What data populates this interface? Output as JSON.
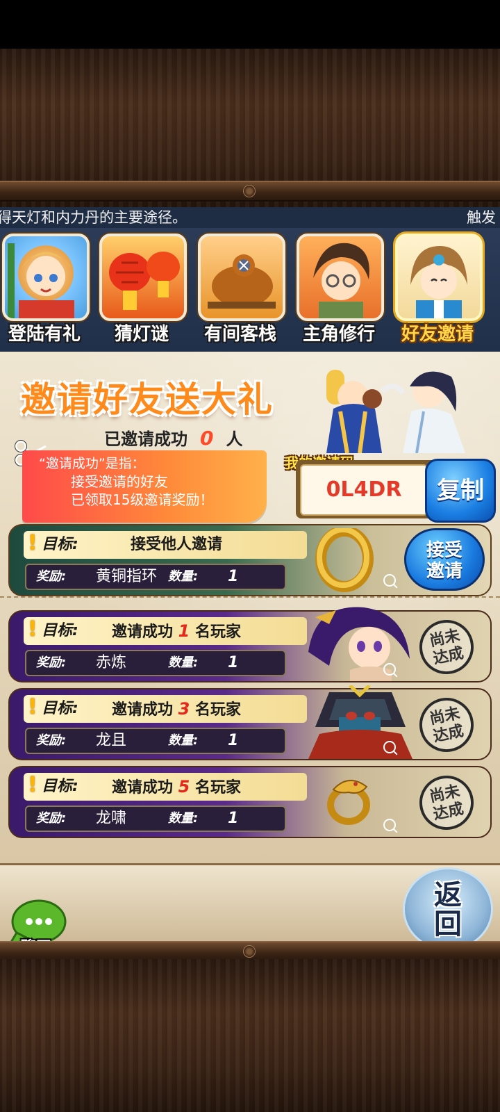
{
  "marquee": {
    "left_text": "得天灯和内力丹的主要途径。",
    "right_text": "触发"
  },
  "tabs": [
    {
      "label": "登陆有礼",
      "icon": "hero-portrait-icon",
      "active": false
    },
    {
      "label": "猜灯谜",
      "icon": "lantern-icon",
      "active": false
    },
    {
      "label": "有间客栈",
      "icon": "roast-chicken-icon",
      "active": false
    },
    {
      "label": "主角修行",
      "icon": "young-hero-portrait-icon",
      "active": false
    },
    {
      "label": "好友邀请",
      "icon": "girl-portrait-icon",
      "active": true
    }
  ],
  "promo": {
    "title": "邀请好友送大礼",
    "success_prefix": "已邀请成功",
    "success_count": "0",
    "success_suffix": "人",
    "note_line1": "“邀请成功”是指：",
    "note_line2": "接受邀请的好友",
    "note_line3": "已领取15级邀请奖励！"
  },
  "invite_code": {
    "label": "我的邀请码",
    "value": "0L4DR",
    "copy_label": "复制"
  },
  "tasks": [
    {
      "goal_label": "目标:",
      "goal_text": "接受他人邀请",
      "goal_num": "",
      "goal_suffix": "",
      "reward_label": "奖励:",
      "reward_name": "黄铜指环",
      "qty_label": "数量:",
      "qty": "1",
      "action": "接受邀请",
      "action_type": "button",
      "item_icon": "brass-ring-icon"
    },
    {
      "goal_label": "目标:",
      "goal_text": "邀请成功",
      "goal_num": "1",
      "goal_suffix": "名玩家",
      "reward_label": "奖励:",
      "reward_name": "赤炼",
      "qty_label": "数量:",
      "qty": "1",
      "action": "尚未达成",
      "action_type": "stamp",
      "item_icon": "purple-hair-warrior-icon"
    },
    {
      "goal_label": "目标:",
      "goal_text": "邀请成功",
      "goal_num": "3",
      "goal_suffix": "名玩家",
      "reward_label": "奖励:",
      "reward_name": "龙且",
      "qty_label": "数量:",
      "qty": "1",
      "action": "尚未达成",
      "action_type": "stamp",
      "item_icon": "masked-general-icon"
    },
    {
      "goal_label": "目标:",
      "goal_text": "邀请成功",
      "goal_num": "5",
      "goal_suffix": "名玩家",
      "reward_label": "奖励:",
      "reward_name": "龙啸",
      "qty_label": "数量:",
      "qty": "1",
      "action": "尚未达成",
      "action_type": "stamp",
      "item_icon": "dragon-ring-icon"
    }
  ],
  "bottom": {
    "chat_label": "聊天",
    "return_label": "返回"
  },
  "colors": {
    "accent_orange": "#ff8a1c",
    "highlight_red": "#e5271b",
    "tab_active": "#ffd54a",
    "panel_bg": "#e2d3b6"
  }
}
